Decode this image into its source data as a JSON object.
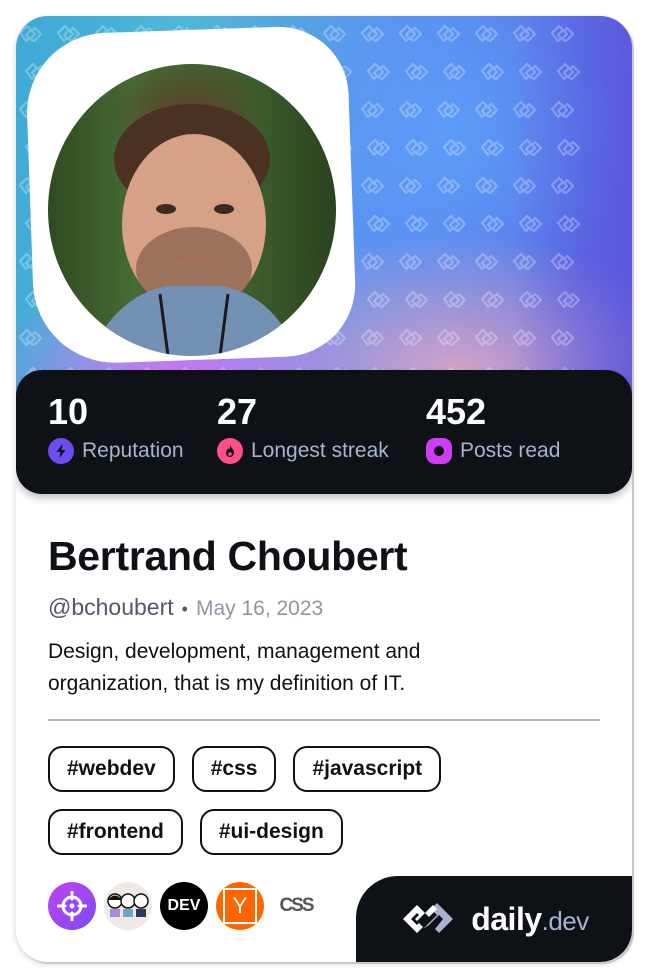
{
  "profile": {
    "name": "Bertrand Choubert",
    "handle": "@bchoubert",
    "separator": "•",
    "joined": "May 16, 2023",
    "bio": "Design, development, management and organization, that is my definition of IT.",
    "avatar_alt": "Profile photo of Bertrand Choubert"
  },
  "stats": [
    {
      "value": "10",
      "label": "Reputation",
      "icon": "lightning-icon",
      "color": "#6e4cf0"
    },
    {
      "value": "27",
      "label": "Longest streak",
      "icon": "flame-icon",
      "color": "#ff4f8b"
    },
    {
      "value": "452",
      "label": "Posts read",
      "icon": "ring-icon",
      "color": "#ce3df3"
    }
  ],
  "tags": [
    "#webdev",
    "#css",
    "#javascript",
    "#frontend",
    "#ui-design"
  ],
  "sources": [
    {
      "name": "target-source",
      "icon": "crosshair-icon",
      "color": "#a244f2"
    },
    {
      "name": "illustration-source",
      "icon": "characters-icon",
      "color": "#efeae8"
    },
    {
      "name": "dev-to",
      "label": "DEV",
      "icon": "dev-icon",
      "color": "#000000"
    },
    {
      "name": "hacker-news",
      "label": "Y",
      "icon": "y-combinator-icon",
      "color": "#ff6600"
    },
    {
      "name": "css-source",
      "label": "CSS",
      "icon": "css-icon",
      "color": "#ffffff"
    }
  ],
  "brand": {
    "name": "daily",
    "suffix": ".dev"
  }
}
